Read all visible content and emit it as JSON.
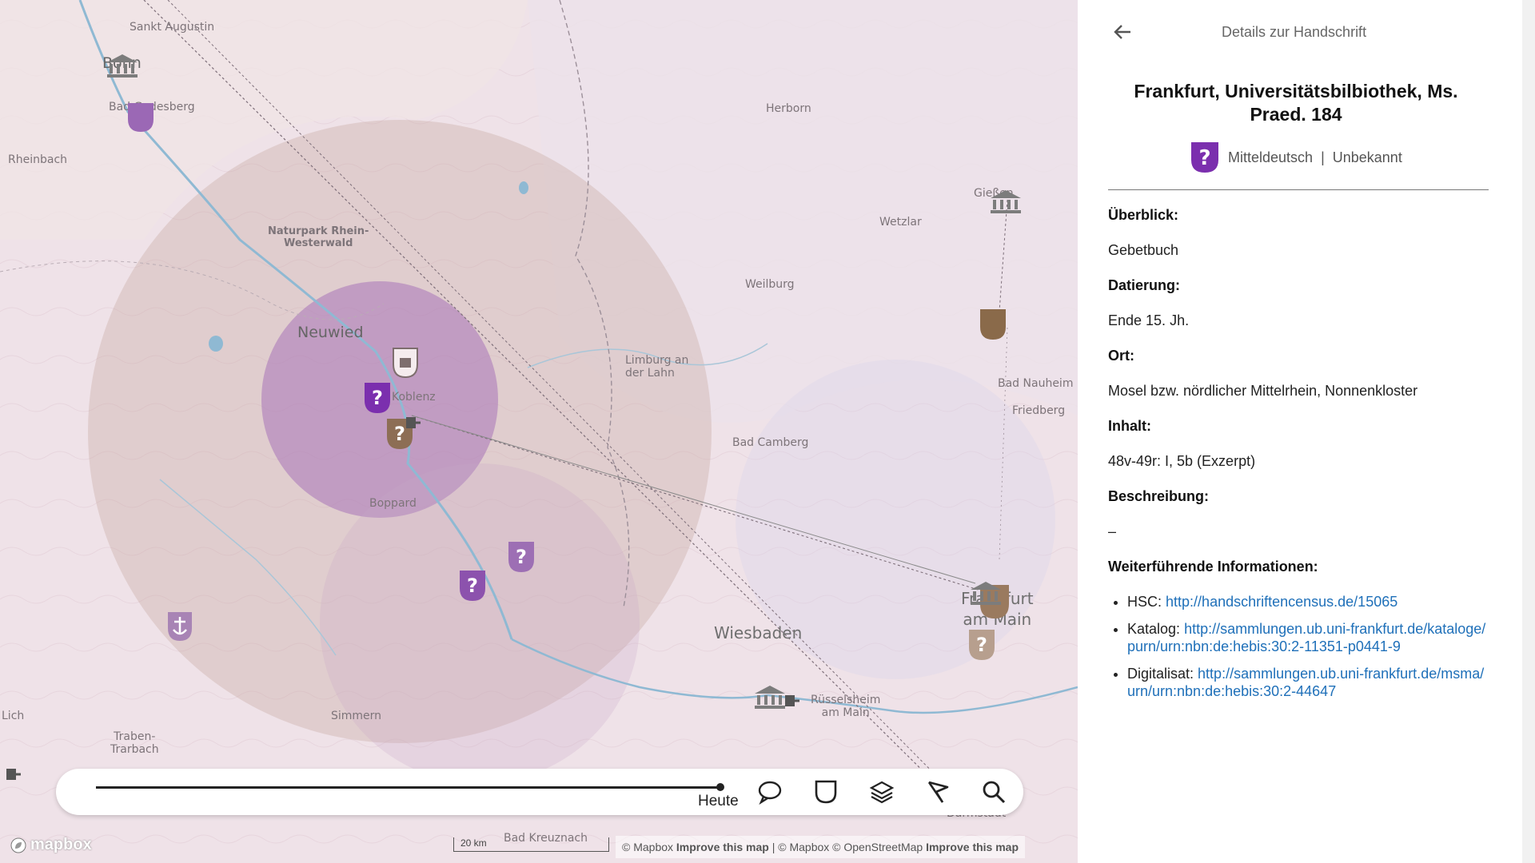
{
  "map": {
    "labels": {
      "sankt_augustin": "Sankt Augustin",
      "bonn": "Bonn",
      "bad_godesberg": "Bad Godesberg",
      "rheinbach": "Rheinbach",
      "naturpark": "Naturpark Rhein-\nWesterwald",
      "neuwied": "Neuwied",
      "koblenz": "Koblenz",
      "boppard": "Boppard",
      "herborn": "Herborn",
      "wetzlar": "Wetzlar",
      "giessen": "Gießen",
      "weilburg": "Weilburg",
      "limburg": "Limburg an\nder Lahn",
      "bad_nauheim": "Bad Nauheim",
      "friedberg": "Friedberg",
      "bad_camberg": "Bad Camberg",
      "wiesbaden": "Wiesbaden",
      "frankfurt": "Frankfurt\nam Main",
      "ruesselsheim": "Rüsselsheim\nam Main",
      "simmern": "Simmern",
      "traben": "Traben-\nTrarbach",
      "lich": "Lich",
      "bad_kreuznach": "Bad Kreuznach",
      "darmstadt": "Darmstadt"
    },
    "attribution": {
      "mapbox": "© Mapbox",
      "improve": "Improve this map",
      "separator": "|",
      "mapbox2": "© Mapbox",
      "osm": "© OpenStreetMap",
      "improve2": "Improve this map"
    },
    "scale": "20 km",
    "logo": "mapbox"
  },
  "toolbar": {
    "timeline_label": "Heute",
    "icons": [
      "speech-bubble-icon",
      "shield-icon",
      "layers-icon",
      "flag-icon",
      "search-icon"
    ]
  },
  "panel": {
    "title": "Details zur Handschrift",
    "manuscript_title": "Frankfurt, Universitätsbilbiothek, Ms. Praed. 184",
    "dialect": "Mitteldeutsch",
    "separator": "|",
    "origin": "Unbekannt",
    "overview_label": "Überblick:",
    "overview_value": "Gebetbuch",
    "dating_label": "Datierung:",
    "dating_value": "Ende 15. Jh.",
    "place_label": "Ort:",
    "place_value": "Mosel bzw. nördlicher Mittelrhein, Nonnenkloster",
    "content_label": "Inhalt:",
    "content_value": "48v-49r: I, 5b (Exzerpt)",
    "description_label": "Beschreibung:",
    "description_value": "–",
    "more_label": "Weiterführende Informationen:",
    "links": [
      {
        "prefix": "HSC:",
        "url": "http://handschriftencensus.de/15065"
      },
      {
        "prefix": "Katalog:",
        "url": "http://sammlungen.ub.uni-frankfurt.de/kataloge/purn/urn:nbn:de:hebis:30:2-11351-p0441-9"
      },
      {
        "prefix": "Digitalisat:",
        "url": "http://sammlungen.ub.uni-frankfurt.de/msma/urn/urn:nbn:de:hebis:30:2-44647"
      }
    ]
  },
  "colors": {
    "purple": "#7b2fae",
    "brown": "#8a6a4a",
    "link": "#1f70b9"
  }
}
